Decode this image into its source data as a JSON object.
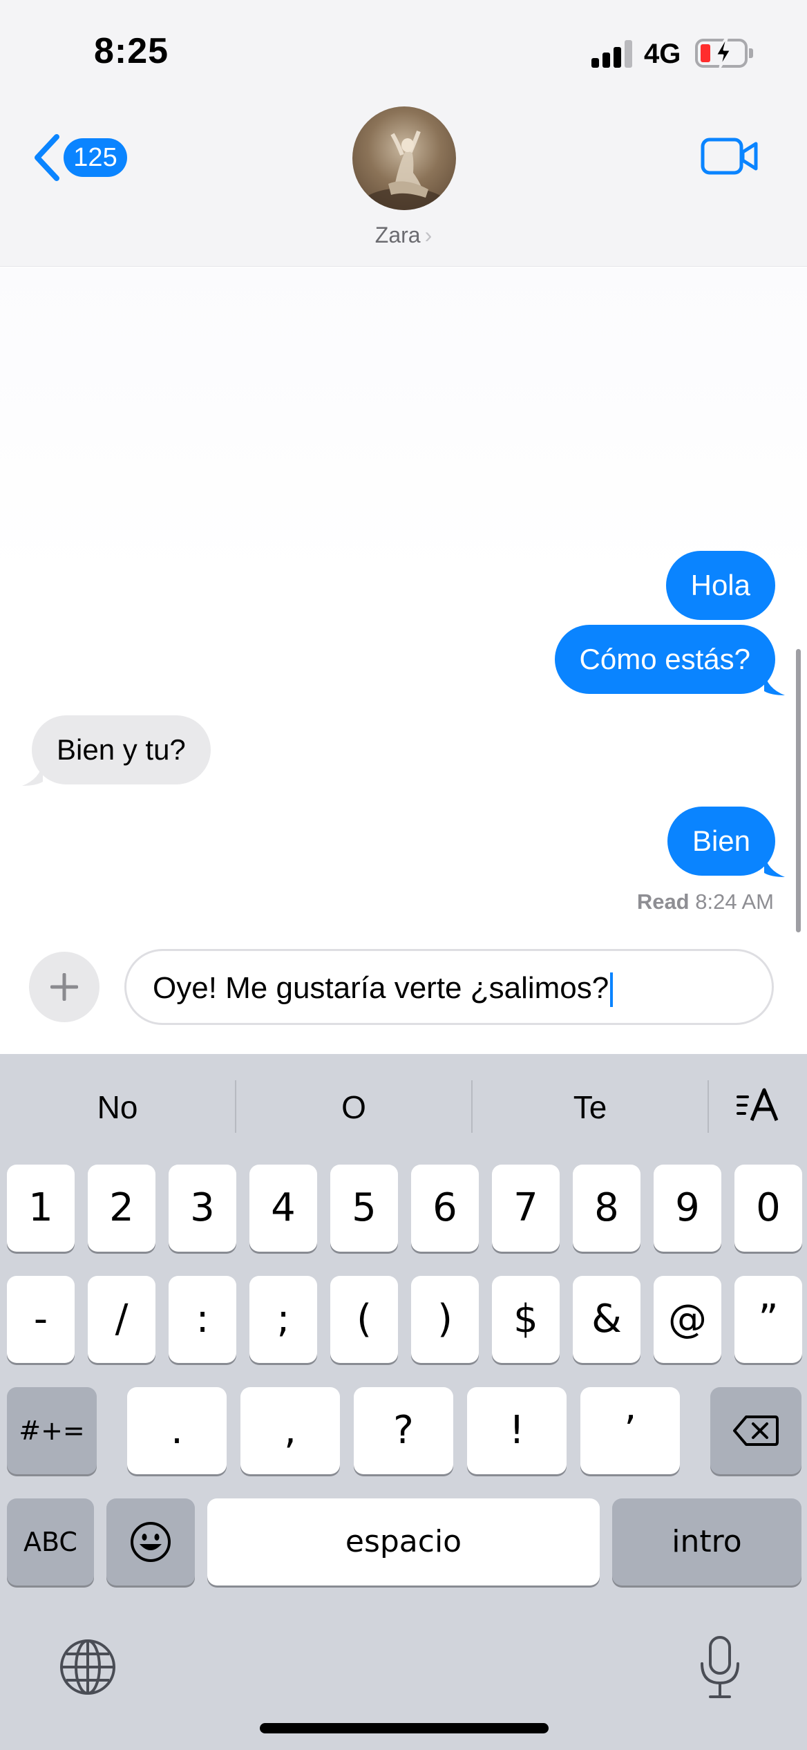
{
  "status_bar": {
    "time": "8:25",
    "network": "4G",
    "signal_bars_filled": 3,
    "signal_bars_total": 4,
    "battery_state": "low, charging",
    "battery_color": "#ff2d2d"
  },
  "header": {
    "back_count": "125",
    "contact_name": "Zara",
    "accent_color": "#0a84ff"
  },
  "conversation": {
    "messages": [
      {
        "direction": "outgoing",
        "text": "Hola"
      },
      {
        "direction": "outgoing",
        "text": "Cómo estás?"
      },
      {
        "direction": "incoming",
        "text": "Bien y tu?"
      },
      {
        "direction": "outgoing",
        "text": "Bien"
      }
    ],
    "read_label": "Read",
    "read_time": "8:24 AM"
  },
  "composer": {
    "value": "Oye! Me gustaría verte ¿salimos?"
  },
  "keyboard": {
    "suggestions": [
      "No",
      "O",
      "Te"
    ],
    "row1": [
      "1",
      "2",
      "3",
      "4",
      "5",
      "6",
      "7",
      "8",
      "9",
      "0"
    ],
    "row2": [
      "-",
      "/",
      ":",
      ";",
      "(",
      ")",
      "$",
      "&",
      "@",
      "”"
    ],
    "row3_toggle": "#+=",
    "row3": [
      ".",
      ",",
      "?",
      "!",
      "’"
    ],
    "abc_label": "ABC",
    "space_label": "espacio",
    "return_label": "intro"
  }
}
